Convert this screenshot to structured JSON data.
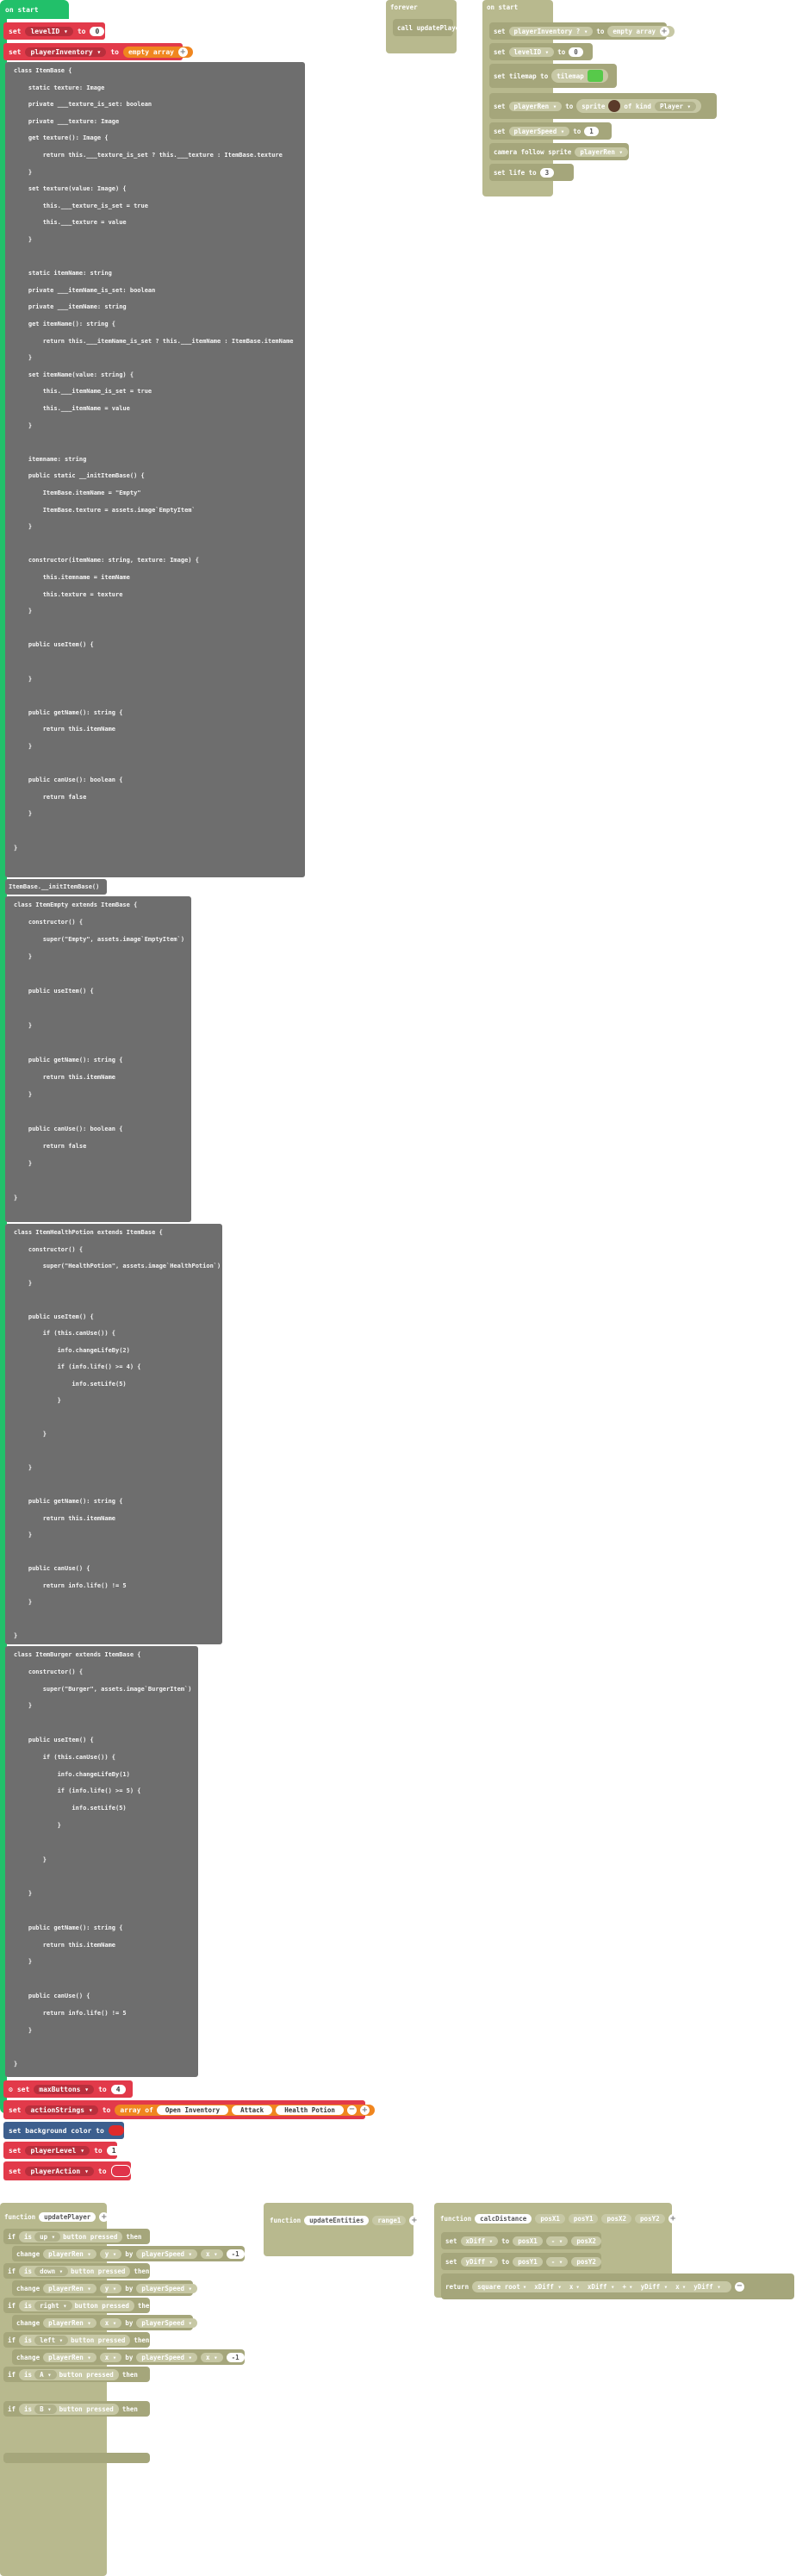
{
  "main": {
    "hat_label": "on start",
    "set_level": {
      "kw": "set",
      "var": "levelID",
      "to": "to",
      "value": "0"
    },
    "set_inventory": {
      "kw": "set",
      "var": "playerInventory",
      "to": "to",
      "value": "empty array"
    },
    "class_base": [
      "class ItemBase {",
      "    static texture: Image",
      "    private ___texture_is_set: boolean",
      "    private ___texture: Image",
      "    get texture(): Image {",
      "        return this.___texture_is_set ? this.___texture : ItemBase.texture",
      "    }",
      "    set texture(value: Image) {",
      "        this.___texture_is_set = true",
      "        this.___texture = value",
      "    }",
      "",
      "    static itemName: string",
      "    private ___itemName_is_set: boolean",
      "    private ___itemName: string",
      "    get itemName(): string {",
      "        return this.___itemName_is_set ? this.___itemName : ItemBase.itemName",
      "    }",
      "    set itemName(value: string) {",
      "        this.___itemName_is_set = true",
      "        this.___itemName = value",
      "    }",
      "",
      "    itemname: string",
      "    public static __initItemBase() {",
      "        ItemBase.itemName = \"Empty\"",
      "        ItemBase.texture = assets.image`EmptyItem`",
      "    }",
      "",
      "    constructor(itemName: string, texture: Image) {",
      "        this.itemname = itemName",
      "        this.texture = texture",
      "    }",
      "",
      "    public useItem() {",
      "",
      "    }",
      "",
      "    public getName(): string {",
      "        return this.itemName",
      "    }",
      "",
      "    public canUse(): boolean {",
      "        return false",
      "    }",
      "",
      "}"
    ],
    "init_call": "ItemBase.__initItemBase()",
    "class_empty": [
      "class ItemEmpty extends ItemBase {",
      "    constructor() {",
      "        super(\"Empty\", assets.image`EmptyItem`)",
      "    }",
      "",
      "    public useItem() {",
      "",
      "    }",
      "",
      "    public getName(): string {",
      "        return this.itemName",
      "    }",
      "",
      "    public canUse(): boolean {",
      "        return false",
      "    }",
      "",
      "}"
    ],
    "class_potion": [
      "class ItemHealthPotion extends ItemBase {",
      "    constructor() {",
      "        super(\"HealthPotion\", assets.image`HealthPotion`)",
      "    }",
      "",
      "    public useItem() {",
      "        if (this.canUse()) {",
      "            info.changeLifeBy(2)",
      "            if (info.life() >= 4) {",
      "                info.setLife(5)",
      "            }",
      "",
      "        }",
      "",
      "    }",
      "",
      "    public getName(): string {",
      "        return this.itemName",
      "    }",
      "",
      "    public canUse() {",
      "        return info.life() != 5",
      "    }",
      "",
      "}"
    ],
    "class_burger": [
      "class ItemBurger extends ItemBase {",
      "    constructor() {",
      "        super(\"Burger\", assets.image`BurgerItem`)",
      "    }",
      "",
      "    public useItem() {",
      "        if (this.canUse()) {",
      "            info.changeLifeBy(1)",
      "            if (info.life() >= 5) {",
      "                info.setLife(5)",
      "            }",
      "",
      "        }",
      "",
      "    }",
      "",
      "    public getName(): string {",
      "        return this.itemName",
      "    }",
      "",
      "    public canUse() {",
      "        return info.life() != 5",
      "    }",
      "",
      "}"
    ],
    "set_maxbuttons": {
      "kw": "set",
      "var": "maxButtons",
      "to": "to",
      "value": "4"
    },
    "set_actionstrings": {
      "kw": "set",
      "var": "actionStrings",
      "to": "to",
      "array_label": "array of",
      "items": [
        "Open Inventory",
        "Attack",
        "Health Potion"
      ]
    },
    "set_bg": {
      "label": "set background color to",
      "color": "#e02b2b"
    },
    "set_playerlevel": {
      "kw": "set",
      "var": "playerLevel",
      "to": "to",
      "value": "1"
    },
    "set_playeraction": {
      "kw": "set",
      "var": "playerAction",
      "to": "to",
      "color": "#e0344a"
    }
  },
  "forever": {
    "hat_label": "forever",
    "call": "call updatePlayer"
  },
  "onstart2": {
    "hat_label": "on start",
    "rows": [
      {
        "kw": "set",
        "var": "playerInventory ?",
        "to": "to",
        "value": "empty array"
      },
      {
        "kw": "set",
        "var": "levelID",
        "to": "to",
        "value": "0"
      },
      {
        "kw": "set tilemap to",
        "value": "tilemap"
      },
      {
        "kw": "set",
        "var": "playerRen",
        "to": "to",
        "value": "sprite",
        "kind": "of kind",
        "kind_val": "Player"
      },
      {
        "kw": "set",
        "var": "playerSpeed",
        "to": "to",
        "value": "1"
      },
      {
        "kw": "camera follow sprite",
        "var": "playerRen"
      },
      {
        "kw": "set life to",
        "value": "3"
      }
    ],
    "tilemap_color": "#57c94a"
  },
  "func_update_player": {
    "kw": "function",
    "name": "updatePlayer",
    "rows": [
      {
        "cond": "is",
        "btn": "up",
        "suffix": "button pressed",
        "then": "then",
        "action": "change",
        "var": "playerRen",
        "axis": "y",
        "by": "by",
        "amount": "playerSpeed",
        "op": "x",
        "num": "-1"
      },
      {
        "cond": "is",
        "btn": "down",
        "suffix": "button pressed",
        "then": "then",
        "action": "change",
        "var": "playerRen",
        "axis": "y",
        "by": "by",
        "amount": "playerSpeed"
      },
      {
        "cond": "is",
        "btn": "right",
        "suffix": "button pressed",
        "then": "then",
        "action": "change",
        "var": "playerRen",
        "axis": "x",
        "by": "by",
        "amount": "playerSpeed"
      },
      {
        "cond": "is",
        "btn": "left",
        "suffix": "button pressed",
        "then": "then",
        "action": "change",
        "var": "playerRen",
        "axis": "x",
        "by": "by",
        "amount": "playerSpeed",
        "op": "x",
        "num": "-1"
      },
      {
        "cond": "is",
        "btn": "A",
        "suffix": "button pressed",
        "then": "then"
      },
      {
        "cond": "is",
        "btn": "B",
        "suffix": "button pressed",
        "then": "then"
      }
    ]
  },
  "func_update_entities": {
    "kw": "function",
    "name": "updateEntities",
    "param": "range1"
  },
  "func_calc": {
    "kw": "function",
    "name": "calcDistance",
    "params": [
      "posX1",
      "posY1",
      "posX2",
      "posY2"
    ],
    "set1": {
      "kw": "set",
      "var": "xDiff",
      "to": "to",
      "a": "posX1",
      "op": "-",
      "b": "posX2"
    },
    "set2": {
      "kw": "set",
      "var": "yDiff",
      "to": "to",
      "a": "posY1",
      "op": "-",
      "b": "posY2"
    },
    "ret": {
      "kw": "return",
      "fn": "square root",
      "a": "xDiff",
      "m1": "x",
      "b": "xDiff",
      "plus": "+",
      "c": "yDiff",
      "m2": "x",
      "d": "yDiff"
    }
  }
}
